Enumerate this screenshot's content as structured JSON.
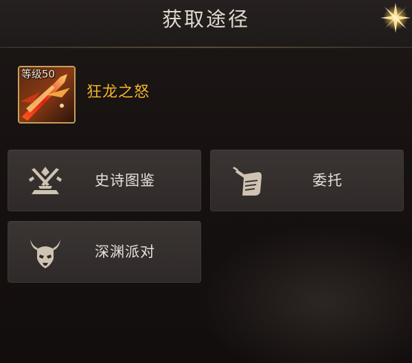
{
  "dialog": {
    "title": "获取途径",
    "close_icon": "close-star-icon"
  },
  "item": {
    "level_badge": "等级50",
    "name": "狂龙之怒",
    "icon": "dragon-wrath-weapon-icon",
    "name_color": "#f2b42a"
  },
  "sources": [
    {
      "label": "史诗图鉴",
      "icon": "crossed-swords-icon"
    },
    {
      "label": "委托",
      "icon": "scroll-quill-icon"
    },
    {
      "label": "深渊派对",
      "icon": "horned-demon-skull-icon"
    }
  ]
}
